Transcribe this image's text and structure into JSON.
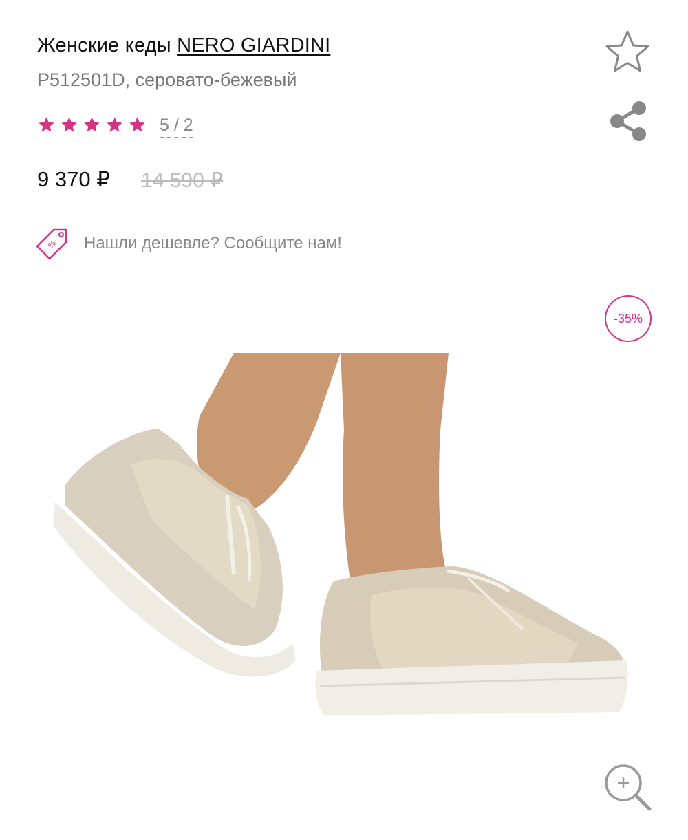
{
  "product": {
    "title_prefix": "Женские кеды",
    "brand": "NERO GIARDINI",
    "subtitle": "P512501D, серовато-бежевый",
    "rating": {
      "stars": 5,
      "max_stars": 5,
      "label": "5 / 2"
    },
    "price": {
      "current": "9 370 ₽",
      "old": "14 590 ₽"
    },
    "cheaper_text": "Нашли дешевле? Сообщите нам!",
    "discount_badge": "-35%"
  },
  "icons": {
    "favorite": "star-outline-icon",
    "share": "share-icon",
    "rating_star": "star-filled-icon",
    "cheaper": "discount-tag-icon",
    "zoom": "zoom-in-icon"
  },
  "colors": {
    "accent": "#d63384",
    "text": "#111111",
    "muted": "#888888",
    "old_price": "#bbbbbb"
  }
}
